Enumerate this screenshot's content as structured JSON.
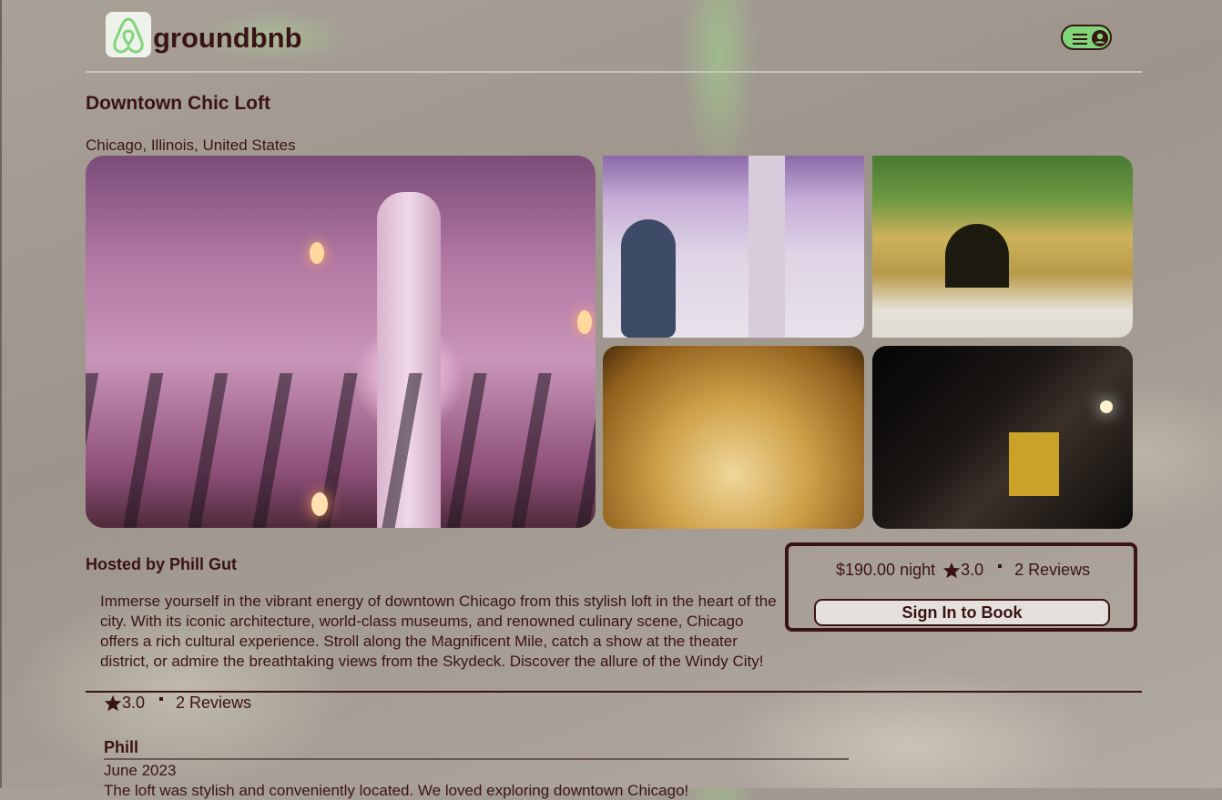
{
  "header": {
    "brand": "groundbnb",
    "logo_icon": "airbnb-logo-icon",
    "menu_icon": "hamburger-icon",
    "user_icon": "user-icon",
    "accent_color": "#7fd67a"
  },
  "listing": {
    "title": "Downtown Chic Loft",
    "location": "Chicago, Illinois, United States",
    "host": "Hosted by Phill Gut",
    "description": "Immerse yourself in the vibrant energy of downtown Chicago from this stylish loft in the heart of the city. With its iconic architecture, world-class museums, and renowned culinary scene, Chicago offers a rich cultural experience. Stroll along the Magnificent Mile, catch a show at the theater district, or admire the breathtaking views from the Skydeck. Discover the allure of the Windy City!",
    "rating": "3.0",
    "reviews_count": "2 Reviews"
  },
  "booking": {
    "price": "$190.00 night",
    "rating": "3.0",
    "reviews_count": "2 Reviews",
    "button_label": "Sign In to Book"
  },
  "reviews": [
    {
      "name": "Phill",
      "date": "June 2023",
      "text": "The loft was stylish and conveniently located. We loved exploring downtown Chicago!"
    }
  ]
}
